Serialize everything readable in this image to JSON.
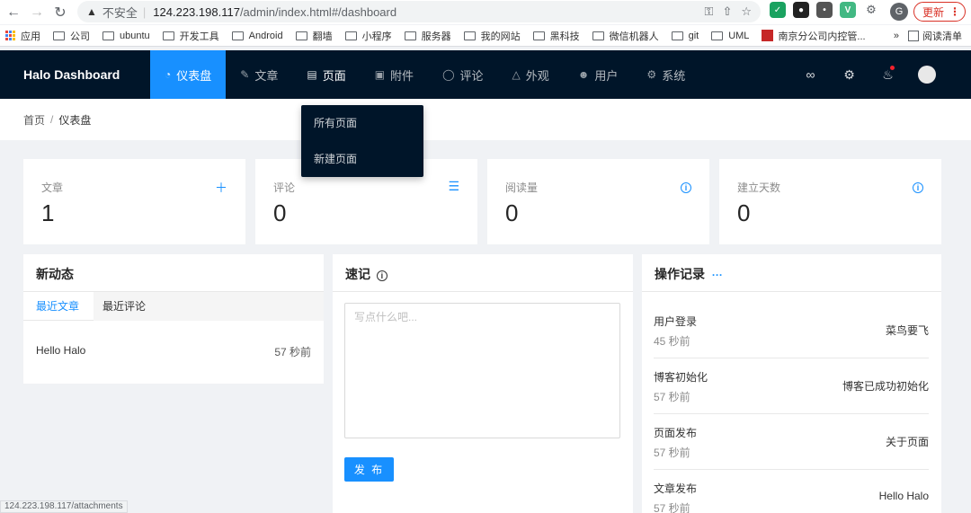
{
  "browser": {
    "insecure_label": "不安全",
    "url_host": "124.223.198.117",
    "url_path": "/admin/index.html#/dashboard",
    "update_label": "更新",
    "profile_initial": "G",
    "bookmarks": [
      "应用",
      "公司",
      "ubuntu",
      "开发工具",
      "Android",
      "翻墙",
      "小程序",
      "服务器",
      "我的网站",
      "黑科技",
      "微信机器人",
      "git",
      "UML",
      "南京分公司内控管..."
    ],
    "reading_list": "阅读清单",
    "more": "»",
    "status_url": "124.223.198.117/attachments"
  },
  "app": {
    "brand": "Halo Dashboard",
    "menu": [
      {
        "label": "仪表盘",
        "icon": "dashboard-icon"
      },
      {
        "label": "文章",
        "icon": "edit-icon"
      },
      {
        "label": "页面",
        "icon": "read-icon"
      },
      {
        "label": "附件",
        "icon": "picture-icon"
      },
      {
        "label": "评论",
        "icon": "message-icon"
      },
      {
        "label": "外观",
        "icon": "skin-icon"
      },
      {
        "label": "用户",
        "icon": "user-icon"
      },
      {
        "label": "系统",
        "icon": "setting-icon"
      }
    ],
    "dropdown": [
      "所有页面",
      "新建页面"
    ],
    "breadcrumb": {
      "home": "首页",
      "sep": "/",
      "current": "仪表盘"
    }
  },
  "stats": [
    {
      "label": "文章",
      "value": "1",
      "icon": "plus-icon"
    },
    {
      "label": "评论",
      "value": "0",
      "icon": "list-icon"
    },
    {
      "label": "阅读量",
      "value": "0",
      "icon": "info-icon"
    },
    {
      "label": "建立天数",
      "value": "0",
      "icon": "info-icon"
    }
  ],
  "activity": {
    "title": "新动态",
    "tabs": [
      "最近文章",
      "最近评论"
    ],
    "posts": [
      {
        "title": "Hello Halo",
        "time": "57 秒前"
      }
    ]
  },
  "notes": {
    "title": "速记",
    "placeholder": "写点什么吧...",
    "publish": "发 布"
  },
  "logs": {
    "title": "操作记录",
    "more": "···",
    "rows": [
      {
        "action": "用户登录",
        "time": "45 秒前",
        "target": "菜鸟要飞"
      },
      {
        "action": "博客初始化",
        "time": "57 秒前",
        "target": "博客已成功初始化"
      },
      {
        "action": "页面发布",
        "time": "57 秒前",
        "target": "关于页面"
      },
      {
        "action": "文章发布",
        "time": "57 秒前",
        "target": "Hello Halo"
      }
    ]
  }
}
